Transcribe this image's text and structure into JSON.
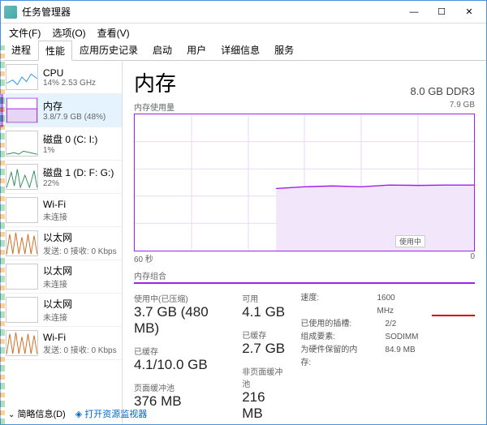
{
  "window": {
    "title": "任务管理器",
    "controls": {
      "min": "—",
      "max": "☐",
      "close": "✕"
    }
  },
  "menu": {
    "file": "文件(F)",
    "options": "选项(O)",
    "view": "查看(V)"
  },
  "tabs": {
    "t0": "进程",
    "t1": "性能",
    "t2": "应用历史记录",
    "t3": "启动",
    "t4": "用户",
    "t5": "详细信息",
    "t6": "服务"
  },
  "sidebar": {
    "cpu": {
      "title": "CPU",
      "sub": "14% 2.53 GHz"
    },
    "memory": {
      "title": "内存",
      "sub": "3.8/7.9 GB (48%)"
    },
    "disk0": {
      "title": "磁盘 0 (C: I:)",
      "sub": "1%"
    },
    "disk1": {
      "title": "磁盘 1 (D: F: G:)",
      "sub": "22%"
    },
    "wifi0": {
      "title": "Wi-Fi",
      "sub": "未连接"
    },
    "eth0": {
      "title": "以太网",
      "sub": "发送: 0 接收: 0 Kbps"
    },
    "eth1": {
      "title": "以太网",
      "sub": "未连接"
    },
    "eth2": {
      "title": "以太网",
      "sub": "未连接"
    },
    "wifi1": {
      "title": "Wi-Fi",
      "sub": "发送: 0 接收: 0 Kbps"
    }
  },
  "main": {
    "title": "内存",
    "spec": "8.0 GB DDR3",
    "usage_label": "内存使用量",
    "usage_max": "7.9 GB",
    "x_left": "60 秒",
    "x_right": "0",
    "inuse_flag": "使用中",
    "composition_label": "内存组合"
  },
  "stats": {
    "inuse_label": "使用中(已压缩)",
    "inuse_value": "3.7 GB (480 MB)",
    "avail_label": "可用",
    "avail_value": "4.1 GB",
    "committed_label": "已缓存",
    "committed_value": "4.1/10.0 GB",
    "cached_label": "已缓存",
    "cached_value": "2.7 GB",
    "page_pool_label": "页面缓冲池",
    "page_pool_value": "376 MB",
    "nonpage_pool_label": "非页面缓冲池",
    "nonpage_pool_value": "216 MB"
  },
  "details": {
    "speed_label": "速度:",
    "speed_value": "1600 MHz",
    "slots_label": "已使用的插槽:",
    "slots_value": "2/2",
    "form_label": "组成要素:",
    "form_value": "SODIMM",
    "hw_label": "为硬件保留的内存:",
    "hw_value": "84.9 MB"
  },
  "bottom": {
    "fewer": "简略信息(D)",
    "resmon": "打开资源监视器"
  },
  "chart_data": {
    "type": "area",
    "title": "内存使用量",
    "ylabel": "GB",
    "ylim": [
      0,
      7.9
    ],
    "x_seconds": [
      60,
      55,
      50,
      45,
      40,
      35,
      30,
      25,
      20,
      15,
      10,
      5,
      0
    ],
    "values": [
      0,
      0,
      0,
      0,
      0,
      3.6,
      3.7,
      3.75,
      3.7,
      3.8,
      3.78,
      3.8,
      3.8
    ],
    "note": "values estimated from gridlines; 0 ≈ no data prior to mid-window"
  }
}
